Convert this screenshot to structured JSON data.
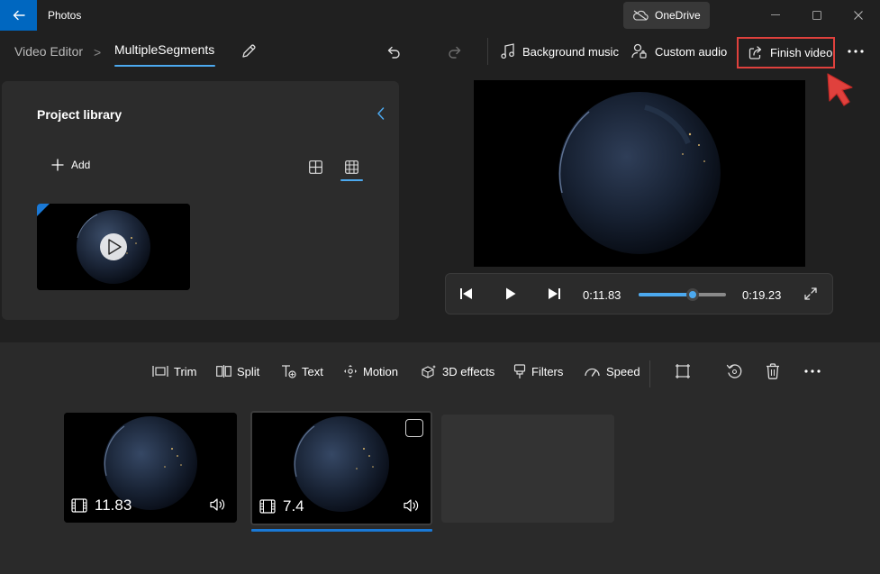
{
  "app": {
    "title": "Photos",
    "onedrive_label": "OneDrive",
    "accent_color": "#0067c0"
  },
  "header": {
    "breadcrumb_root": "Video Editor",
    "breadcrumb_sep": ">",
    "project_name": "MultipleSegments",
    "background_music_label": "Background music",
    "custom_audio_label": "Custom audio",
    "finish_video_label": "Finish video",
    "highlight_color": "#e0413d"
  },
  "library": {
    "title": "Project library",
    "add_label": "Add"
  },
  "player": {
    "current_time": "0:11.83",
    "total_time": "0:19.23",
    "progress": 0.615
  },
  "toolbar": {
    "tools": [
      {
        "label": "Trim",
        "icon": "trim-icon"
      },
      {
        "label": "Split",
        "icon": "split-icon"
      },
      {
        "label": "Text",
        "icon": "text-icon"
      },
      {
        "label": "Motion",
        "icon": "motion-icon"
      },
      {
        "label": "3D effects",
        "icon": "3d-effects-icon"
      },
      {
        "label": "Filters",
        "icon": "filters-icon"
      },
      {
        "label": "Speed",
        "icon": "speed-icon"
      }
    ]
  },
  "storyboard": {
    "clips": [
      {
        "duration": "11.83"
      },
      {
        "duration": "7.4"
      }
    ]
  }
}
